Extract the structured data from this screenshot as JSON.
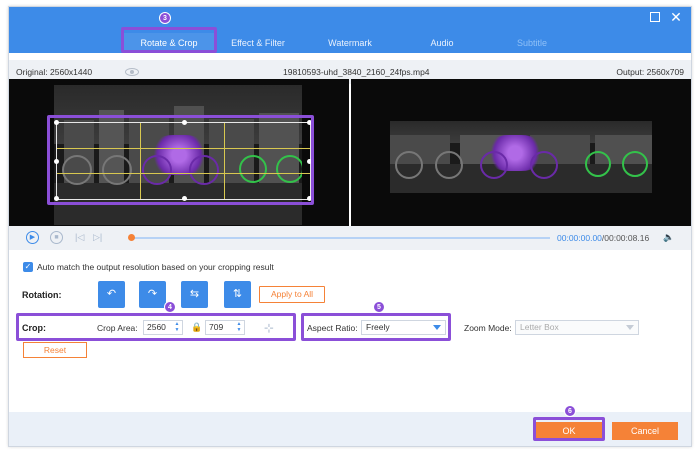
{
  "tabs": [
    {
      "label": "Rotate & Crop",
      "active": true
    },
    {
      "label": "Effect & Filter",
      "active": false
    },
    {
      "label": "Watermark",
      "active": false
    },
    {
      "label": "Audio",
      "active": false
    },
    {
      "label": "Subtitle",
      "active": false
    }
  ],
  "info": {
    "original": "Original: 2560x1440",
    "filename": "19810593-uhd_3840_2160_24fps.mp4",
    "output": "Output: 2560x709"
  },
  "player": {
    "current_time": "00:00:00.00",
    "total_time": "/00:00:08.16",
    "progress": 0
  },
  "auto_match": {
    "checked": true,
    "label": "Auto match the output resolution based on your cropping result"
  },
  "rotation": {
    "label": "Rotation:",
    "apply_label": "Apply to All",
    "buttons": [
      "rotate-left",
      "rotate-right",
      "flip-horizontal",
      "flip-vertical"
    ]
  },
  "crop": {
    "label": "Crop:",
    "area_label": "Crop Area:",
    "width": "2560",
    "height": "709",
    "reset_label": "Reset"
  },
  "aspect": {
    "label": "Aspect Ratio:",
    "value": "Freely"
  },
  "zoom": {
    "label": "Zoom Mode:",
    "value": "Letter Box"
  },
  "footer": {
    "ok_label": "OK",
    "cancel_label": "Cancel"
  },
  "badges": {
    "b3": "3",
    "b4": "4",
    "b5": "5",
    "b6": "6"
  },
  "colors": {
    "accent": "#3d8be8",
    "action": "#f58237",
    "highlight": "#8b4fd8"
  }
}
